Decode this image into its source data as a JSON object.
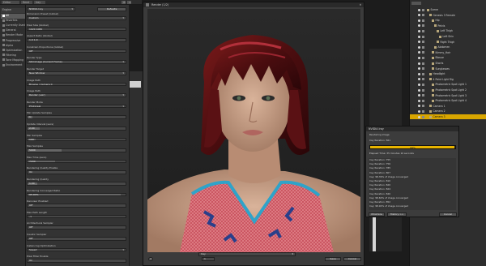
{
  "topbar": {
    "tab_editor": "Editor",
    "tab_params": "Rend",
    "tab_extra": "Iray"
  },
  "render_settings": {
    "preset_label": "Engine",
    "preset_value": "NVIDIA Iray",
    "defaults_label": "Defaults"
  },
  "categories": [
    {
      "label": "All",
      "selected": true
    },
    {
      "label": "Favorites",
      "selected": false
    },
    {
      "label": "Currently Used",
      "selected": false
    },
    {
      "label": "General",
      "selected": false
    },
    {
      "label": "Render Mode",
      "selected": false
    },
    {
      "label": "Progressive",
      "selected": false
    },
    {
      "label": "Alpha",
      "selected": false
    },
    {
      "label": "Optimization",
      "selected": false
    },
    {
      "label": "Filtering",
      "selected": false
    },
    {
      "label": "Tone Mapping",
      "selected": false
    },
    {
      "label": "Environment",
      "selected": false
    }
  ],
  "parameters": [
    {
      "label": "Dimension Preset (Global)",
      "value": "Custom",
      "dropdown": true
    },
    {
      "label": "Pixel Size (Global)",
      "value": "1920  1080",
      "dropdown": false
    },
    {
      "label": "Aspect Ratio (Global)",
      "value": "1.0   1.0",
      "dropdown": false
    },
    {
      "label": "Constrain Proportions (Global)",
      "value": "Off",
      "dropdown": false
    },
    {
      "label": "Render Type",
      "value": "Still Image (Current Frame)",
      "dropdown": true
    },
    {
      "label": "Render Target",
      "value": "New Window",
      "dropdown": true
    },
    {
      "label": "Image Path",
      "value": "Browse / Camera 0",
      "dropdown": false
    },
    {
      "label": "Image Path",
      "value": "Render (.exr)",
      "dropdown": true
    },
    {
      "label": "Render Mode",
      "value": "Photoreal",
      "dropdown": true
    },
    {
      "label": "Min Update Samples",
      "value": "1",
      "dropdown": false,
      "fill": 0.05
    },
    {
      "label": "Update Interval (secs)",
      "value": "2.00",
      "dropdown": false,
      "fill": 0.12
    },
    {
      "label": "Min Samples",
      "value": "100",
      "dropdown": false,
      "fill": 0.08
    },
    {
      "label": "Max Samples",
      "value": "5000",
      "dropdown": false,
      "fill": 0.35
    },
    {
      "label": "Max Time (secs)",
      "value": "7200",
      "dropdown": false,
      "fill": 0.28
    },
    {
      "label": "Rendering Quality Enable",
      "value": "On",
      "dropdown": false
    },
    {
      "label": "Rendering Quality",
      "value": "1.00",
      "dropdown": false,
      "fill": 0.1
    },
    {
      "label": "Rendering Converged Ratio",
      "value": "95.00%",
      "dropdown": false,
      "fill": 0.95
    },
    {
      "label": "Denoiser Enabled",
      "value": "Off",
      "dropdown": false
    },
    {
      "label": "Max Path Length",
      "value": "-1",
      "dropdown": false,
      "fill": 0.0
    },
    {
      "label": "Architectural Sampler",
      "value": "Off",
      "dropdown": false
    },
    {
      "label": "Caustic Sampler",
      "value": "Off",
      "dropdown": false
    },
    {
      "label": "Instancing Optimization",
      "value": "Speed",
      "dropdown": true
    },
    {
      "label": "Pixel Filter Enable",
      "value": "On",
      "dropdown": false
    }
  ],
  "render_window": {
    "title": "Render (1/2)",
    "close": "✕",
    "select_value": "Iray",
    "history_value": "1",
    "save_label": "Save",
    "cancel_label": "Cancel",
    "help_icon": "?"
  },
  "scene": {
    "items": [
      {
        "label": "Scene",
        "highlight": false
      },
      {
        "label": "Genesis 3 Female",
        "highlight": false
      },
      {
        "label": "Hip",
        "highlight": false
      },
      {
        "label": "Pelvis",
        "highlight": false
      },
      {
        "label": "Left Thigh",
        "highlight": false
      },
      {
        "label": "Left Shin",
        "highlight": false
      },
      {
        "label": "Right Thigh",
        "highlight": false
      },
      {
        "label": "Abdomen",
        "highlight": false
      },
      {
        "label": "Kimmy_Hair",
        "highlight": false
      },
      {
        "label": "Blouse",
        "highlight": false
      },
      {
        "label": "Shorts",
        "highlight": false
      },
      {
        "label": "Sunglasses",
        "highlight": false
      },
      {
        "label": "Headlight",
        "highlight": false
      },
      {
        "label": "4 Point Light Rig",
        "highlight": false
      },
      {
        "label": "Photometric Spot Light 1",
        "highlight": false
      },
      {
        "label": "Photometric Spot Light 2",
        "highlight": false
      },
      {
        "label": "Photometric Spot Light 3",
        "highlight": false
      },
      {
        "label": "Photometric Spot Light 4",
        "highlight": false
      },
      {
        "label": "Camera 1",
        "highlight": false
      },
      {
        "label": "Camera 2",
        "highlight": false
      },
      {
        "label": "Camera 3",
        "highlight": true
      }
    ]
  },
  "iray_status": {
    "title": "NVIDIA Iray",
    "state": "Rendering image",
    "iteration": "Iray Iteration: 561",
    "progress_percent": 99,
    "progress_label": "99%",
    "elapsed": "Elapsed Time: 35 minutes 10 seconds",
    "log": [
      "Iray Iteration: 755",
      "Iray Iteration: 756",
      "Iray Iteration: 785",
      "Iray Iteration: 807",
      "Iray: 98.39% of image converged",
      "Iray Iteration: 810",
      "Iray Iteration: 820",
      "Iray Iteration: 824",
      "Iray Iteration: 840",
      "Iray: 98.60% of image converged",
      "Iray Iteration: 852",
      "Iray: 98.92% of image converged"
    ],
    "minimize_label": "Minimize",
    "history_label": "History >>",
    "cancel_label": "Cancel"
  }
}
